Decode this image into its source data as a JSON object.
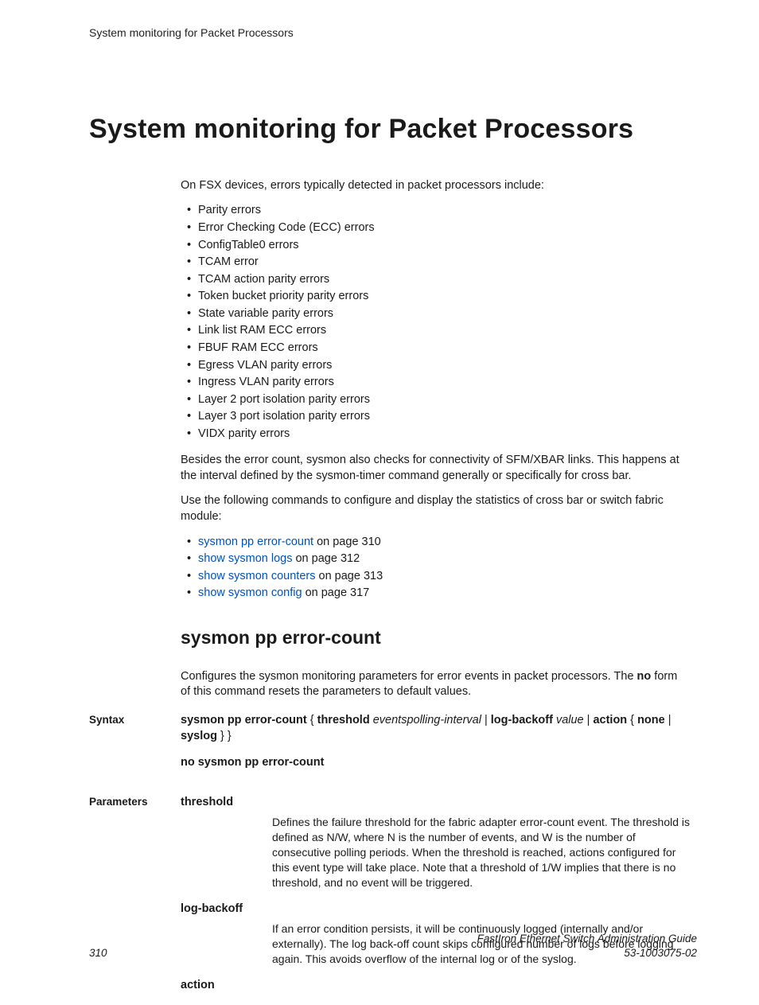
{
  "breadcrumb": "System monitoring for Packet Processors",
  "main_heading": "System monitoring for Packet Processors",
  "intro": "On FSX devices, errors typically detected in packet processors include:",
  "error_list": [
    "Parity errors",
    "Error Checking Code (ECC) errors",
    "ConfigTable0 errors",
    "TCAM error",
    "TCAM action parity errors",
    "Token bucket priority parity errors",
    "State variable parity errors",
    "Link list RAM ECC errors",
    "FBUF RAM ECC errors",
    "Egress VLAN parity errors",
    "Ingress VLAN parity errors",
    "Layer 2 port isolation parity errors",
    "Layer 3 port isolation parity errors",
    "VIDX parity errors"
  ],
  "para2": "Besides the error count, sysmon also checks for connectivity of SFM/XBAR links. This happens at the interval defined by the sysmon-timer command generally or specifically for cross bar.",
  "para3": "Use the following commands to configure and display the statistics of cross bar or switch fabric module:",
  "xrefs": [
    {
      "link": "sysmon pp error-count",
      "suffix": " on page 310"
    },
    {
      "link": "show sysmon logs",
      "suffix": " on page 312"
    },
    {
      "link": "show sysmon counters",
      "suffix": " on page 313"
    },
    {
      "link": "show sysmon config",
      "suffix": " on page 317"
    }
  ],
  "sub_heading": "sysmon pp error-count",
  "sub_intro_a": "Configures the sysmon monitoring parameters for error events in packet processors. The ",
  "sub_intro_b": "no",
  "sub_intro_c": " form of this command resets the parameters to default values.",
  "labels": {
    "syntax": "Syntax",
    "parameters": "Parameters"
  },
  "syntax": {
    "cmd": "sysmon pp error-count",
    "lb": " { ",
    "kw_threshold": "threshold",
    "sp": " ",
    "var_events": "events",
    "var_polling": "polling-interval",
    "sep": " | ",
    "kw_logbackoff": "log-backoff",
    "var_value": "value",
    "kw_action": "action",
    "lb2": " { ",
    "kw_none": "none",
    "kw_syslog": "syslog",
    "rb": " } }"
  },
  "no_syntax": "no sysmon pp error-count",
  "params": [
    {
      "name": "threshold",
      "desc": "Defines the failure threshold for the fabric adapter error-count event. The threshold is defined as N/W, where N is the number of events, and W is the number of consecutive polling periods. When the threshold is reached, actions configured for this event type will take place. Note that a threshold of 1/W implies that there is no threshold, and no event will be triggered."
    },
    {
      "name": "log-backoff",
      "desc": "If an error condition persists, it will be continuously logged (internally and/or externally). The log back-off count skips configured number of logs before logging again. This avoids overflow of the internal log or of the syslog."
    },
    {
      "name": "action",
      "desc": ""
    }
  ],
  "footer": {
    "page": "310",
    "guide": "FastIron Ethernet Switch Administration Guide",
    "docnum": "53-1003075-02"
  }
}
